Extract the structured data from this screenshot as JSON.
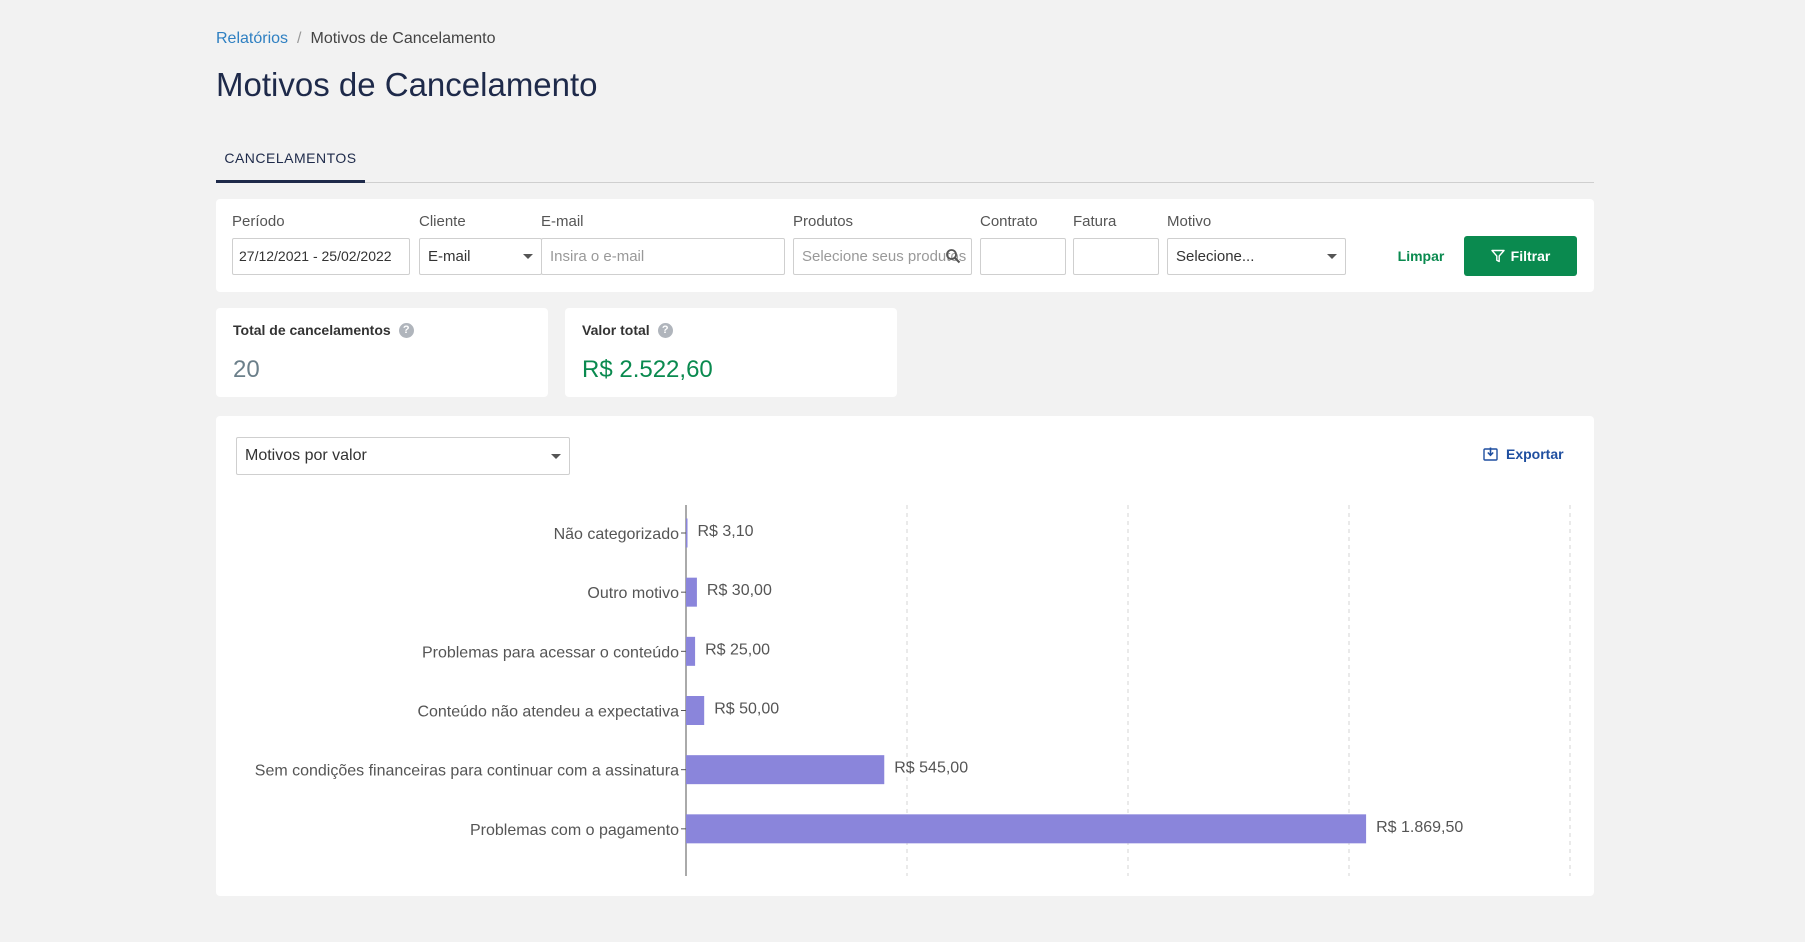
{
  "breadcrumb": {
    "parent": "Relatórios",
    "separator": "/",
    "current": "Motivos de Cancelamento"
  },
  "page_title": "Motivos de Cancelamento",
  "tabs": [
    {
      "label": "CANCELAMENTOS",
      "active": true
    }
  ],
  "filters": {
    "periodo": {
      "label": "Período",
      "value": "27/12/2021  -  25/02/2022"
    },
    "cliente": {
      "label": "Cliente",
      "value": "E-mail"
    },
    "email": {
      "label": "E-mail",
      "placeholder": "Insira o e-mail"
    },
    "produtos": {
      "label": "Produtos",
      "placeholder": "Selecione seus produtos"
    },
    "contrato": {
      "label": "Contrato",
      "value": ""
    },
    "fatura": {
      "label": "Fatura",
      "value": ""
    },
    "motivo": {
      "label": "Motivo",
      "value": "Selecione..."
    },
    "clear_label": "Limpar",
    "filter_label": "Filtrar"
  },
  "metrics": {
    "total": {
      "label": "Total de cancelamentos",
      "value": "20"
    },
    "valor": {
      "label": "Valor total",
      "value": "R$ 2.522,60"
    }
  },
  "chart_panel": {
    "mode": "Motivos por valor",
    "export_label": "Exportar"
  },
  "colors": {
    "accent_green": "#0a8a4f",
    "bar": "#8a85db",
    "link": "#2f80c2",
    "title": "#1e2a4a",
    "metric_total": "#6b7f8a"
  },
  "chart_data": {
    "type": "bar",
    "orientation": "horizontal",
    "categories": [
      "Não categorizado",
      "Outro motivo",
      "Problemas para acessar o conteúdo",
      "Conteúdo não atendeu a expectativa",
      "Sem condições financeiras para continuar com a assinatura",
      "Problemas com o pagamento"
    ],
    "values": [
      3.1,
      30.0,
      25.0,
      50.0,
      545.0,
      1869.5
    ],
    "data_labels": [
      "R$ 3,10",
      "R$ 30,00",
      "R$ 25,00",
      "R$ 50,00",
      "R$ 545,00",
      "R$ 1.869,50"
    ],
    "xlim": [
      0,
      2430
    ],
    "grid": "vertical-dashed",
    "title": "",
    "xlabel": "",
    "ylabel": ""
  }
}
